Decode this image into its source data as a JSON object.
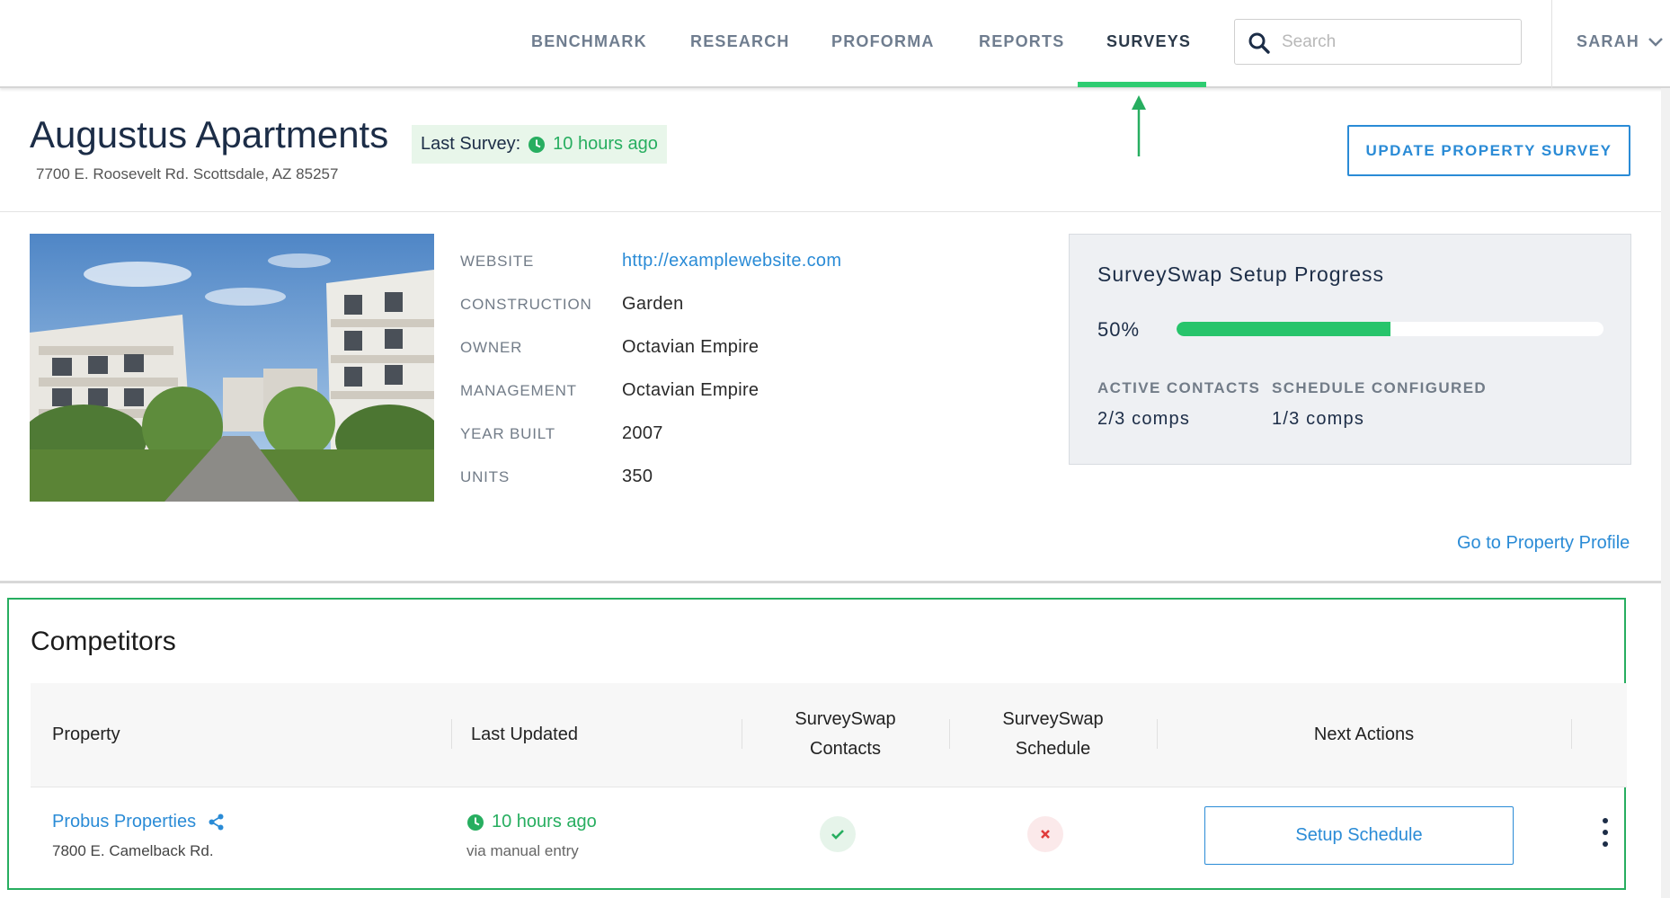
{
  "nav": {
    "items": [
      "BENCHMARK",
      "RESEARCH",
      "PROFORMA",
      "REPORTS",
      "SURVEYS"
    ],
    "active": "SURVEYS",
    "search_placeholder": "Search",
    "user": "SARAH"
  },
  "property": {
    "name": "Augustus Apartments",
    "address": "7700 E. Roosevelt Rd. Scottsdale, AZ 85257",
    "last_survey_label": "Last Survey:",
    "last_survey_value": "10 hours ago",
    "update_button": "UPDATE PROPERTY SURVEY",
    "details": [
      {
        "label": "WEBSITE",
        "value": "http://examplewebsite.com"
      },
      {
        "label": "CONSTRUCTION",
        "value": "Garden"
      },
      {
        "label": "OWNER",
        "value": "Octavian Empire"
      },
      {
        "label": "MANAGEMENT",
        "value": "Octavian Empire"
      },
      {
        "label": "YEAR BUILT",
        "value": "2007"
      },
      {
        "label": "UNITS",
        "value": "350"
      }
    ],
    "profile_link": "Go to Property Profile"
  },
  "setup_progress": {
    "title": "SurveySwap Setup Progress",
    "percent_label": "50%",
    "percent": 50,
    "active_contacts_label": "ACTIVE CONTACTS",
    "active_contacts_value": "2/3 comps",
    "schedule_label": "SCHEDULE CONFIGURED",
    "schedule_value": "1/3 comps"
  },
  "competitors": {
    "title": "Competitors",
    "columns": {
      "property": "Property",
      "last_updated": "Last Updated",
      "contacts_1": "SurveySwap",
      "contacts_2": "Contacts",
      "schedule_1": "SurveySwap",
      "schedule_2": "Schedule",
      "next_actions": "Next Actions"
    },
    "rows": [
      {
        "name": "Probus Properties",
        "address": "7800 E. Camelback Rd.",
        "updated": "10 hours ago",
        "source": "via manual entry",
        "contacts_status": "complete",
        "schedule_status": "missing",
        "action": "Setup Schedule"
      }
    ]
  },
  "colors": {
    "accent_blue": "#2a8bd6",
    "success_green": "#27ae60",
    "error_red": "#e03c3c",
    "title_navy": "#1c2d47"
  }
}
